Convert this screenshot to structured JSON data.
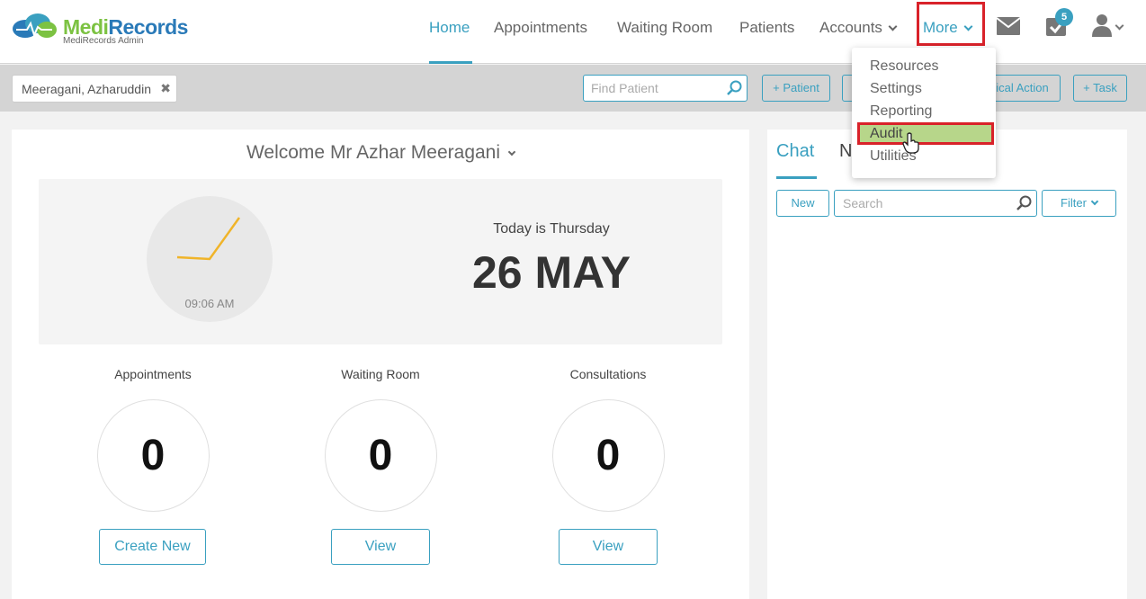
{
  "brand": {
    "name_part1": "Medi",
    "name_part2": "Records",
    "subtitle": "MediRecords Admin"
  },
  "nav": {
    "items": [
      {
        "label": "Home",
        "active": true
      },
      {
        "label": "Appointments"
      },
      {
        "label": "Waiting Room"
      },
      {
        "label": "Patients"
      },
      {
        "label": "Accounts"
      },
      {
        "label": "More"
      }
    ],
    "task_badge": "5"
  },
  "toolbar": {
    "patient_tab": "Meeragani, Azharuddin",
    "find_placeholder": "Find Patient",
    "buttons": [
      "+ Patient",
      "",
      "ical Action",
      "+ Task"
    ]
  },
  "more_menu": {
    "items": [
      "Resources",
      "Settings",
      "Reporting",
      "Audit",
      "Utilities"
    ],
    "highlighted": "Audit"
  },
  "dashboard": {
    "welcome": "Welcome Mr Azhar Meeragani",
    "clock_time": "09:06 AM",
    "today_text": "Today is Thursday",
    "date_big": "26 MAY",
    "stats": [
      {
        "label": "Appointments",
        "value": "0",
        "button": "Create New"
      },
      {
        "label": "Waiting Room",
        "value": "0",
        "button": "View"
      },
      {
        "label": "Consultations",
        "value": "0",
        "button": "View"
      }
    ]
  },
  "side_panel": {
    "tab_chat": "Chat",
    "tab_other": "N",
    "new_button": "New",
    "search_placeholder": "Search",
    "filter_button": "Filter"
  },
  "colors": {
    "accent": "#3aa0c0",
    "brand_green": "#7cc242",
    "brand_blue": "#2a7ab8",
    "highlight_red": "#d9222a",
    "selected_green": "#b7d68a",
    "clock_hand": "#f0b429"
  }
}
